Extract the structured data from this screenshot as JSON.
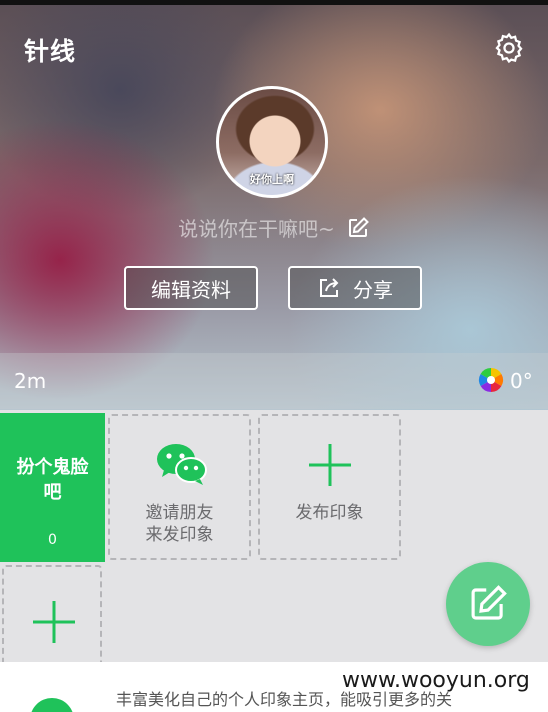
{
  "header": {
    "app_title": "针线",
    "settings_icon": "gear-icon"
  },
  "profile": {
    "avatar_text": "好你上啊",
    "status_placeholder": "说说你在干嘛吧~",
    "edit_status_icon": "pencil-square-icon",
    "edit_profile_label": "编辑资料",
    "share_label": "分享",
    "share_icon": "share-arrow-icon"
  },
  "meta": {
    "distance": "2m",
    "weather_icon": "color-wheel-icon",
    "temperature": "0°"
  },
  "cards": {
    "green_title_line1": "扮个鬼脸",
    "green_title_line2": "吧",
    "green_count": "0",
    "invite_line1": "邀请朋友",
    "invite_line2": "来发印象",
    "invite_icon": "wechat-icon",
    "publish_label": "发布印象",
    "publish_icon": "plus-icon",
    "add_icon": "plus-icon"
  },
  "fab": {
    "icon": "compose-icon"
  },
  "bottom": {
    "text": "丰富美化自己的个人印象主页，能吸引更多的关"
  },
  "watermark": "www.wooyun.org",
  "colors": {
    "accent": "#1fc25a",
    "fab": "#5fcf8c",
    "tile_border": "#b5b5b8"
  }
}
